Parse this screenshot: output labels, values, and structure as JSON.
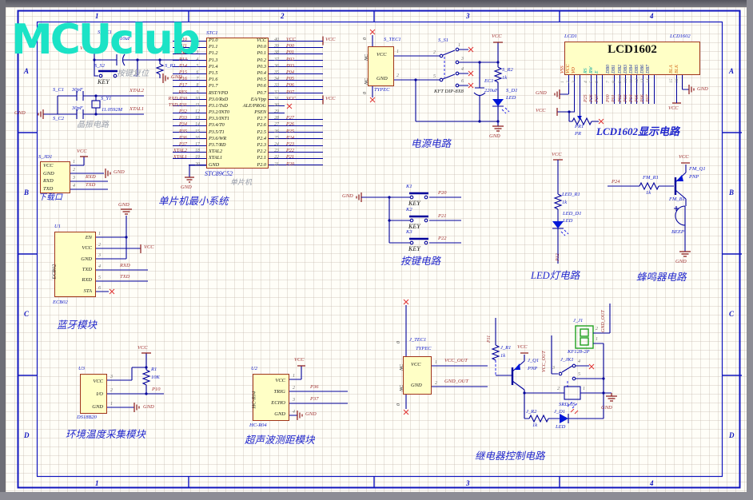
{
  "colors": {
    "wire": "#00009B",
    "power_symbol": "#8B1A1A",
    "net_label": "#A03232",
    "designator": "#1620C8",
    "logo": "#1BE3C6",
    "caption": "#2026CC",
    "part_fill": "#FFFFC6",
    "part_border": "#A0341B",
    "terminal_green": "#1FA01F"
  },
  "logo": {
    "text": "MCUclub"
  },
  "zones": {
    "cols": [
      "1",
      "2",
      "3",
      "4"
    ],
    "rows": [
      "A",
      "B",
      "C",
      "D"
    ]
  },
  "reset": {
    "cap_ref": "S_EC1",
    "cap_val": "10uF",
    "vcc": "VCC",
    "key_ref": "S_S2",
    "key_label": "KEY",
    "res_ref": "S_R1",
    "net": "RES",
    "gnd": "GND",
    "caption": "按键复位"
  },
  "crystal": {
    "c1_ref": "S_C1",
    "c1_val": "30pF",
    "c2_ref": "S_C2",
    "c2_val": "30pF",
    "y_ref": "S_Y1",
    "y_val": "11.0592M",
    "net_top": "XTAL2",
    "net_bot": "XTAL1",
    "gnd": "GND",
    "caption": "晶振电路"
  },
  "download": {
    "ref": "S_JD1",
    "pins": [
      {
        "name": "VCC",
        "num": "1"
      },
      {
        "name": "GND",
        "num": "2"
      },
      {
        "name": "RXD",
        "num": "3"
      },
      {
        "name": "TXD",
        "num": "4"
      }
    ],
    "vcc": "VCC",
    "gnd": "GND",
    "rxd": "RXD",
    "txd": "TXD",
    "caption": "下载口"
  },
  "mcu": {
    "ref": "STC1",
    "part": "STC89C52",
    "sub": "单片机",
    "title": "单片机最小系统",
    "gnd": "GND",
    "vcc1": "VCC",
    "vcc2": "VCC",
    "rows": [
      {
        "lnet": "P10",
        "lnum": "1",
        "lname": "P1.0",
        "rname": "VCC",
        "rnum": "40",
        "rnet": "VCC"
      },
      {
        "lnet": "P11",
        "lnum": "2",
        "lname": "P1.1",
        "rname": "P0.0",
        "rnum": "39",
        "rnet": "P00"
      },
      {
        "lnet": "P12",
        "lnum": "3",
        "lname": "P1.2",
        "rname": "P0.1",
        "rnum": "38",
        "rnet": "P01"
      },
      {
        "lnet": "P13",
        "lnum": "4",
        "lname": "P1.3",
        "rname": "P0.2",
        "rnum": "37",
        "rnet": "P02"
      },
      {
        "lnet": "P14",
        "lnum": "5",
        "lname": "P1.4",
        "rname": "P0.3",
        "rnum": "36",
        "rnet": "P03"
      },
      {
        "lnet": "P15",
        "lnum": "6",
        "lname": "P1.5",
        "rname": "P0.4",
        "rnum": "35",
        "rnet": "P04"
      },
      {
        "lnet": "P16",
        "lnum": "7",
        "lname": "P1.6",
        "rname": "P0.5",
        "rnum": "34",
        "rnet": "P05"
      },
      {
        "lnet": "P17",
        "lnum": "8",
        "lname": "P1.7",
        "rname": "P0.6",
        "rnum": "33",
        "rnet": "P06"
      },
      {
        "lnet": "RES",
        "lnum": "9",
        "lname": "RST/VPD",
        "rname": "P0.7",
        "rnum": "32",
        "rnet": "P07"
      },
      {
        "lnet": "RXD P30",
        "lnum": "10",
        "lname": "P3.0/RxD",
        "rname": "EA/Vpp",
        "rnum": "31",
        "rnet": "VCC"
      },
      {
        "lnet": "TXD P31",
        "lnum": "11",
        "lname": "P3.1/TxD",
        "rname": "ALE/PROG",
        "rnum": "30",
        "rnet": ""
      },
      {
        "lnet": "P32",
        "lnum": "12",
        "lname": "P3.2/INT0",
        "rname": "PSEN",
        "rnum": "29",
        "rnet": ""
      },
      {
        "lnet": "P33",
        "lnum": "13",
        "lname": "P3.3/INT1",
        "rname": "P2.7",
        "rnum": "28",
        "rnet": "P27"
      },
      {
        "lnet": "P34",
        "lnum": "14",
        "lname": "P3.4/T0",
        "rname": "P2.6",
        "rnum": "27",
        "rnet": "P26"
      },
      {
        "lnet": "P35",
        "lnum": "15",
        "lname": "P3.5/T1",
        "rname": "P2.5",
        "rnum": "26",
        "rnet": "P25"
      },
      {
        "lnet": "P36",
        "lnum": "16",
        "lname": "P3.6/WR",
        "rname": "P2.4",
        "rnum": "25",
        "rnet": "P24"
      },
      {
        "lnet": "P37",
        "lnum": "17",
        "lname": "P3.7/RD",
        "rname": "P2.3",
        "rnum": "24",
        "rnet": "P23"
      },
      {
        "lnet": "XTAL2",
        "lnum": "18",
        "lname": "XTAL2",
        "rname": "P2.2",
        "rnum": "23",
        "rnet": "P22"
      },
      {
        "lnet": "XTAL1",
        "lnum": "19",
        "lname": "XTAL1",
        "rname": "P2.1",
        "rnum": "22",
        "rnet": "P21"
      },
      {
        "lnet": "",
        "lnum": "20",
        "lname": "GND",
        "rname": "P2.0",
        "rnum": "21",
        "rnet": "P20"
      }
    ]
  },
  "power": {
    "ref": "S_TEC1",
    "part": "TYPEC",
    "nc1": "NC",
    "nc2": "NC",
    "pin_vcc": "VCC",
    "pin_gnd": "GND",
    "num1": "1",
    "num2": "2",
    "zero_top": "0",
    "zero_bot": "0",
    "sw_ref": "S_S1",
    "sw_part": "KFT DIP-8X8",
    "sw_nums": [
      "1",
      "2",
      "3",
      "4",
      "5",
      "6"
    ],
    "cap_ref": "EC1",
    "cap_val": "220uF",
    "res_ref": "S_R2",
    "res_val": "1k",
    "led_ref": "S_D1",
    "led_val": "LED",
    "vcc": "VCC",
    "gnd": "GND",
    "caption": "电源电路"
  },
  "lcd": {
    "ref": "LCD1",
    "ref2": "LCD1602",
    "title": "LCD1602",
    "pins": [
      {
        "name": "VSS",
        "num": "1",
        "net": ""
      },
      {
        "name": "VCC",
        "num": "2",
        "net": ""
      },
      {
        "name": "VO",
        "num": "3",
        "net": ""
      },
      {
        "name": "RS",
        "num": "4",
        "net": "P25"
      },
      {
        "name": "RW",
        "num": "5",
        "net": "P26"
      },
      {
        "name": "E",
        "num": "6",
        "net": "P27"
      },
      {
        "name": "DB0",
        "num": "7",
        "net": "P00"
      },
      {
        "name": "DB1",
        "num": "8",
        "net": "P01"
      },
      {
        "name": "DB2",
        "num": "9",
        "net": "P02"
      },
      {
        "name": "DB3",
        "num": "10",
        "net": "P03"
      },
      {
        "name": "DB4",
        "num": "11",
        "net": "P04"
      },
      {
        "name": "DB5",
        "num": "12",
        "net": "P05"
      },
      {
        "name": "DB6",
        "num": "13",
        "net": "P06"
      },
      {
        "name": "DB7",
        "num": "14",
        "net": "P07"
      },
      {
        "name": "BLA",
        "num": "15",
        "net": ""
      },
      {
        "name": "BLK",
        "num": "16",
        "net": ""
      }
    ],
    "gnd_left": "GND",
    "vcc_left": "VCC",
    "pot_ref": "PR1",
    "pot_val": "PR",
    "vcc_right": "VCC",
    "gnd_right": "GND",
    "caption": "LCD1602显示电路"
  },
  "keys": {
    "gnd": "GND",
    "items": [
      {
        "ref": "K1",
        "label": "KEY",
        "net": "P20"
      },
      {
        "ref": "K2",
        "label": "KEY",
        "net": "P21"
      },
      {
        "ref": "K3",
        "label": "KEY",
        "net": "P22"
      }
    ],
    "caption": "按键电路"
  },
  "led": {
    "vcc": "VCC",
    "res_ref": "LED_R1",
    "res_val": "1k",
    "led_ref": "LED_D1",
    "led_val": "LED",
    "net": "P12",
    "caption": "LED灯电路"
  },
  "buzzer": {
    "net": "P24",
    "res_ref": "FM_R1",
    "res_val": "1k",
    "q_ref": "FM_Q1",
    "q_val": "PNP",
    "vcc": "VCC",
    "bz_ref": "FM_B1",
    "bz_val": "BEEP",
    "gnd": "GND",
    "caption": "蜂鸣器电路"
  },
  "bt": {
    "ref": "U1",
    "part": "ECB02",
    "part_label": "ECB02",
    "pins": [
      {
        "name": "EN",
        "num": "1"
      },
      {
        "name": "VCC",
        "num": "2"
      },
      {
        "name": "GND",
        "num": "3"
      },
      {
        "name": "TXD",
        "num": "4"
      },
      {
        "name": "RXD",
        "num": "5"
      },
      {
        "name": "STA",
        "num": "6"
      }
    ],
    "gnd": "GND",
    "vcc": "VCC",
    "rxd": "RXD",
    "txd": "TXD",
    "caption": "蓝牙模块"
  },
  "temp": {
    "ref": "U3",
    "part": "DS18B20",
    "pins": [
      {
        "name": "VCC",
        "num": "3"
      },
      {
        "name": "I/O",
        "num": "2"
      },
      {
        "name": "GND",
        "num": "1"
      }
    ],
    "vcc": "VCC",
    "res_ref": "R1",
    "res_val": "10K",
    "net": "P10",
    "gnd": "GND",
    "caption": "环境温度采集模块"
  },
  "ultra": {
    "ref": "U2",
    "part": "HC-R04",
    "part_label": "HC-R04",
    "pins": [
      {
        "name": "VCC",
        "num": "1"
      },
      {
        "name": "TRIG",
        "num": "2"
      },
      {
        "name": "ECHO",
        "num": "3"
      },
      {
        "name": "GND",
        "num": "4"
      }
    ],
    "vcc": "VCC",
    "trig_net": "P36",
    "echo_net": "P37",
    "gnd": "GND",
    "caption": "超声波测距模块"
  },
  "relay": {
    "ref": "J_TEC1",
    "part": "TYPEC",
    "nc1": "NC",
    "nc2": "NC",
    "pin_vcc": "VCC",
    "pin_gnd": "GND",
    "num1": "1",
    "num2": "2",
    "zero_top": "0",
    "zero_bot": "0",
    "vcc_out": "VCC_OUT",
    "gnd_out": "GND_OUT",
    "p11": "P11",
    "r1_ref": "J_R1",
    "r1_val": "1k",
    "q_ref": "J_Q1",
    "q_val": "PNP",
    "vcc": "VCC",
    "vcc_out_v": "VCC_OUT",
    "sw_ref": "J_JK1",
    "sw_nums": [
      "3",
      "4",
      "5"
    ],
    "conn_ref": "J_J1",
    "conn_part": "KF128-2P",
    "conn_nums": [
      "2",
      "1"
    ],
    "gnd_out_v": "GND_OUT",
    "coil_ref": "SRD-05",
    "coil_nums": [
      "2",
      "1"
    ],
    "gnd": "GND",
    "r2_ref": "J_R2",
    "r2_val": "1k",
    "d_ref": "J_D1",
    "d_val": "LED",
    "caption": "继电器控制电路"
  }
}
